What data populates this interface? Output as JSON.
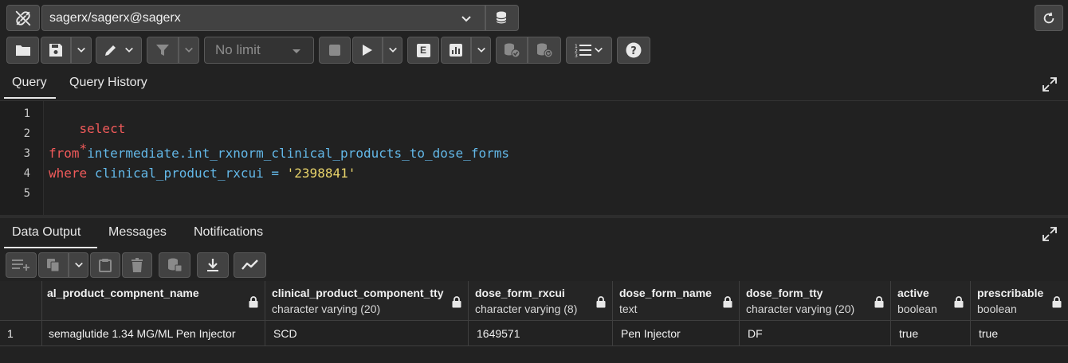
{
  "connection": {
    "name": "sagerx/sagerx@sagerx"
  },
  "toolbar": {
    "limit_value": "No limit",
    "explain_label": "E"
  },
  "editor_tabs": [
    {
      "label": "Query"
    },
    {
      "label": "Query History"
    }
  ],
  "editor": {
    "line_numbers": [
      "1",
      "2",
      "3",
      "4",
      "5"
    ],
    "lines": {
      "l1_kw": "select",
      "l2_star": "*",
      "l3_kw": "from",
      "l3_table": "intermediate.int_rxnorm_clinical_products_to_dose_forms",
      "l4_kw": "where",
      "l4_col": "clinical_product_rxcui",
      "l4_op": "=",
      "l4_str": "'2398841'"
    }
  },
  "output_tabs": [
    {
      "label": "Data Output"
    },
    {
      "label": "Messages"
    },
    {
      "label": "Notifications"
    }
  ],
  "grid": {
    "columns": [
      {
        "name": "al_product_compnent_name",
        "type": ""
      },
      {
        "name": "clinical_product_component_tty",
        "type": "character varying (20)"
      },
      {
        "name": "dose_form_rxcui",
        "type": "character varying (8)"
      },
      {
        "name": "dose_form_name",
        "type": "text"
      },
      {
        "name": "dose_form_tty",
        "type": "character varying (20)"
      },
      {
        "name": "active",
        "type": "boolean"
      },
      {
        "name": "prescribable",
        "type": "boolean"
      }
    ],
    "rows": [
      {
        "row_number": "1",
        "cells": [
          "semaglutide 1.34 MG/ML Pen Injector",
          "SCD",
          "1649571",
          "Pen Injector",
          "DF",
          "true",
          "true"
        ]
      }
    ]
  },
  "colors": {
    "background": "#222222",
    "button": "#424242",
    "keyword": "#f05a5a",
    "identifier": "#63b8e8",
    "string": "#e8d36a"
  }
}
